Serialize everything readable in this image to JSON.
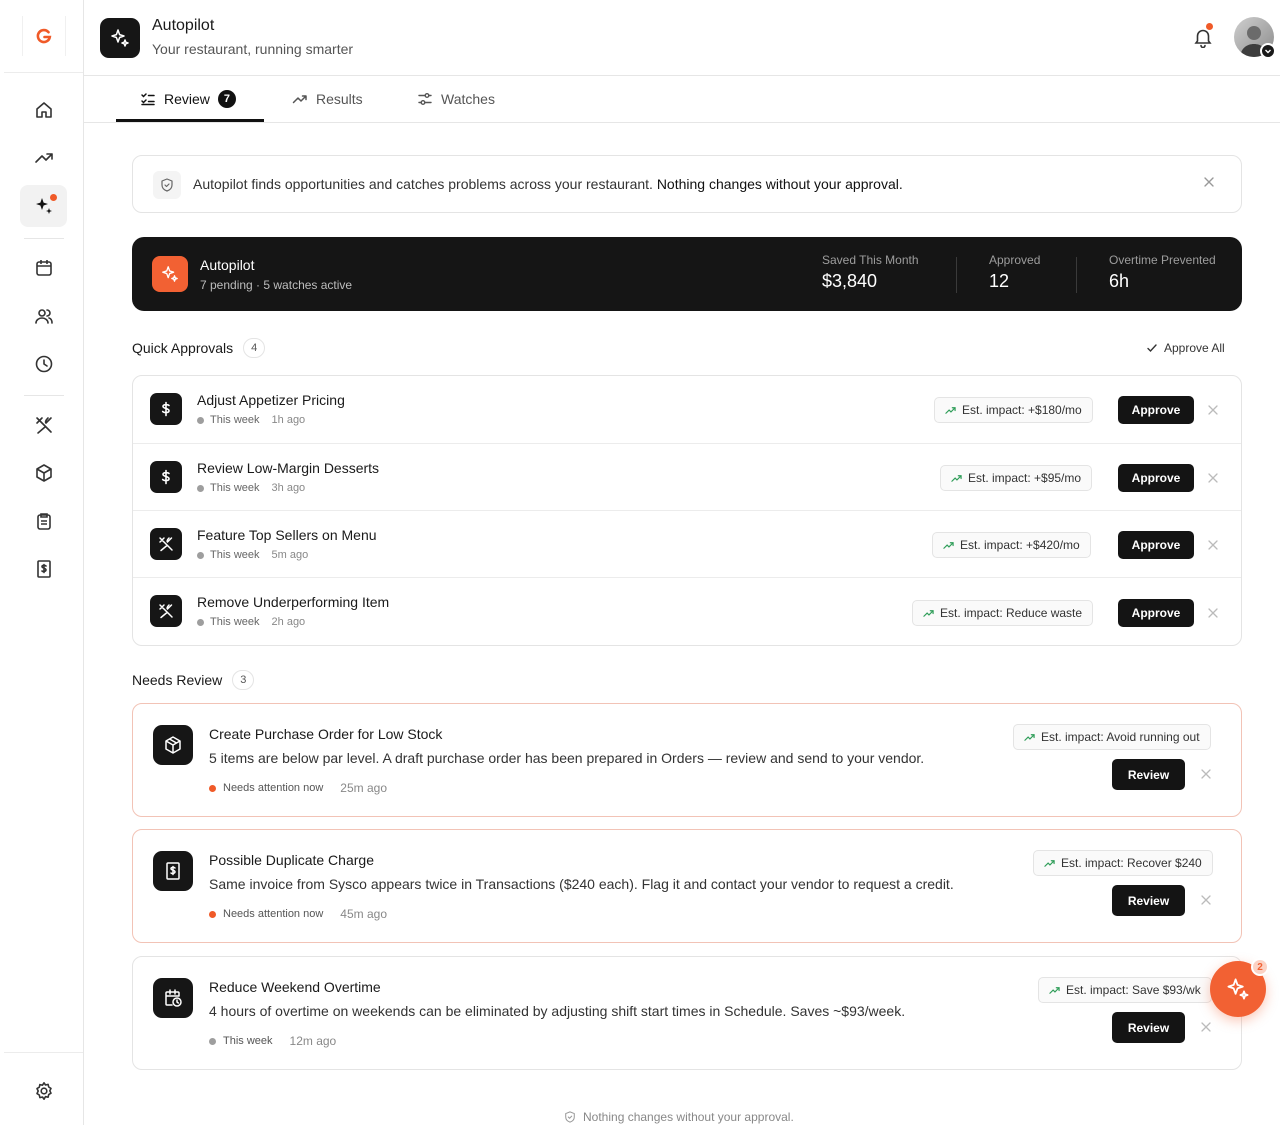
{
  "header": {
    "title": "Autopilot",
    "subtitle": "Your restaurant, running smarter"
  },
  "tabs": [
    {
      "label": "Review",
      "count": "7",
      "icon": "checklist-icon"
    },
    {
      "label": "Results",
      "icon": "trend-up-icon"
    },
    {
      "label": "Watches",
      "icon": "sliders-icon"
    }
  ],
  "banner": {
    "text_part1": "Autopilot finds opportunities and catches problems across your restaurant.",
    "text_part2": "Nothing changes without your approval."
  },
  "summary": {
    "title": "Autopilot",
    "subtitle": "7 pending · 5 watches active",
    "stats": [
      {
        "label": "Saved This Month",
        "value": "$3,840"
      },
      {
        "label": "Approved",
        "value": "12"
      },
      {
        "label": "Overtime Prevented",
        "value": "6h"
      }
    ]
  },
  "quick_approvals": {
    "title": "Quick Approvals",
    "count": "4",
    "approve_all_label": "Approve All",
    "items": [
      {
        "title": "Adjust Appetizer Pricing",
        "when": "This week",
        "ago": "1h ago",
        "impact": "Est. impact: +$180/mo",
        "button": "Approve",
        "icon": "dollar-icon"
      },
      {
        "title": "Review Low-Margin Desserts",
        "when": "This week",
        "ago": "3h ago",
        "impact": "Est. impact: +$95/mo",
        "button": "Approve",
        "icon": "dollar-icon"
      },
      {
        "title": "Feature Top Sellers on Menu",
        "when": "This week",
        "ago": "5m ago",
        "impact": "Est. impact: +$420/mo",
        "button": "Approve",
        "icon": "utensils-icon"
      },
      {
        "title": "Remove Underperforming Item",
        "when": "This week",
        "ago": "2h ago",
        "impact": "Est. impact: Reduce waste",
        "button": "Approve",
        "icon": "utensils-icon"
      }
    ]
  },
  "needs_review": {
    "title": "Needs Review",
    "count": "3",
    "items": [
      {
        "title": "Create Purchase Order for Low Stock",
        "description": "5 items are below par level. A draft purchase order has been prepared in Orders — review and send to your vendor.",
        "status": "Needs attention now",
        "ago": "25m ago",
        "impact": "Est. impact: Avoid running out",
        "button": "Review",
        "icon": "box-icon"
      },
      {
        "title": "Possible Duplicate Charge",
        "description": "Same invoice from Sysco appears twice in Transactions ($240 each). Flag it and contact your vendor to request a credit.",
        "status": "Needs attention now",
        "ago": "45m ago",
        "impact": "Est. impact: Recover $240",
        "button": "Review",
        "icon": "receipt-dollar-icon"
      },
      {
        "title": "Reduce Weekend Overtime",
        "description": "4 hours of overtime on weekends can be eliminated by adjusting shift start times in Schedule. Saves ~$93/week.",
        "status": "This week",
        "ago": "12m ago",
        "impact": "Est. impact: Save $93/wk",
        "button": "Review",
        "icon": "calendar-clock-icon"
      }
    ]
  },
  "fab": {
    "badge": "2"
  },
  "footer": {
    "note": "Nothing changes without your approval."
  },
  "colors": {
    "accent": "#f26133",
    "dark": "#151515",
    "alert_border": "#f2c3b6"
  }
}
